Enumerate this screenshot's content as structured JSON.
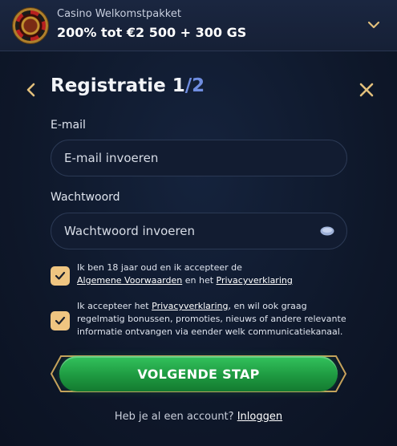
{
  "promo": {
    "subtitle": "Casino Welkomstpakket",
    "title": "200% tot €2 500 + 300 GS",
    "icon": "roulette-wheel-icon"
  },
  "registration": {
    "title": "Registratie 1",
    "step_total": "/2",
    "email": {
      "label": "E-mail",
      "placeholder": "E-mail invoeren",
      "value": ""
    },
    "password": {
      "label": "Wachtwoord",
      "placeholder": "Wachtwoord invoeren",
      "value": ""
    },
    "consent_terms": {
      "checked": true,
      "text_before": "Ik ben 18 jaar oud en ik accepteer de ",
      "link_terms": "Algemene Voorwaarden",
      "text_middle": " en het ",
      "link_privacy": "Privacyverklaring"
    },
    "consent_marketing": {
      "checked": true,
      "text_before": "Ik accepteer het ",
      "link_privacy": "Privacyverklaring",
      "text_after": ", en wil ook graag regelmatig bonussen, promoties, nieuws of andere relevante informatie ontvangen via eender welk communicatiekanaal."
    },
    "next_button": "VOLGENDE STAP",
    "login_prompt": "Heb je al een account? ",
    "login_link": "Inloggen"
  },
  "colors": {
    "accent_gold": "#efc581",
    "cta_green": "#1e9a41",
    "background": "#0d1528",
    "step_blue": "#6f8de0"
  }
}
